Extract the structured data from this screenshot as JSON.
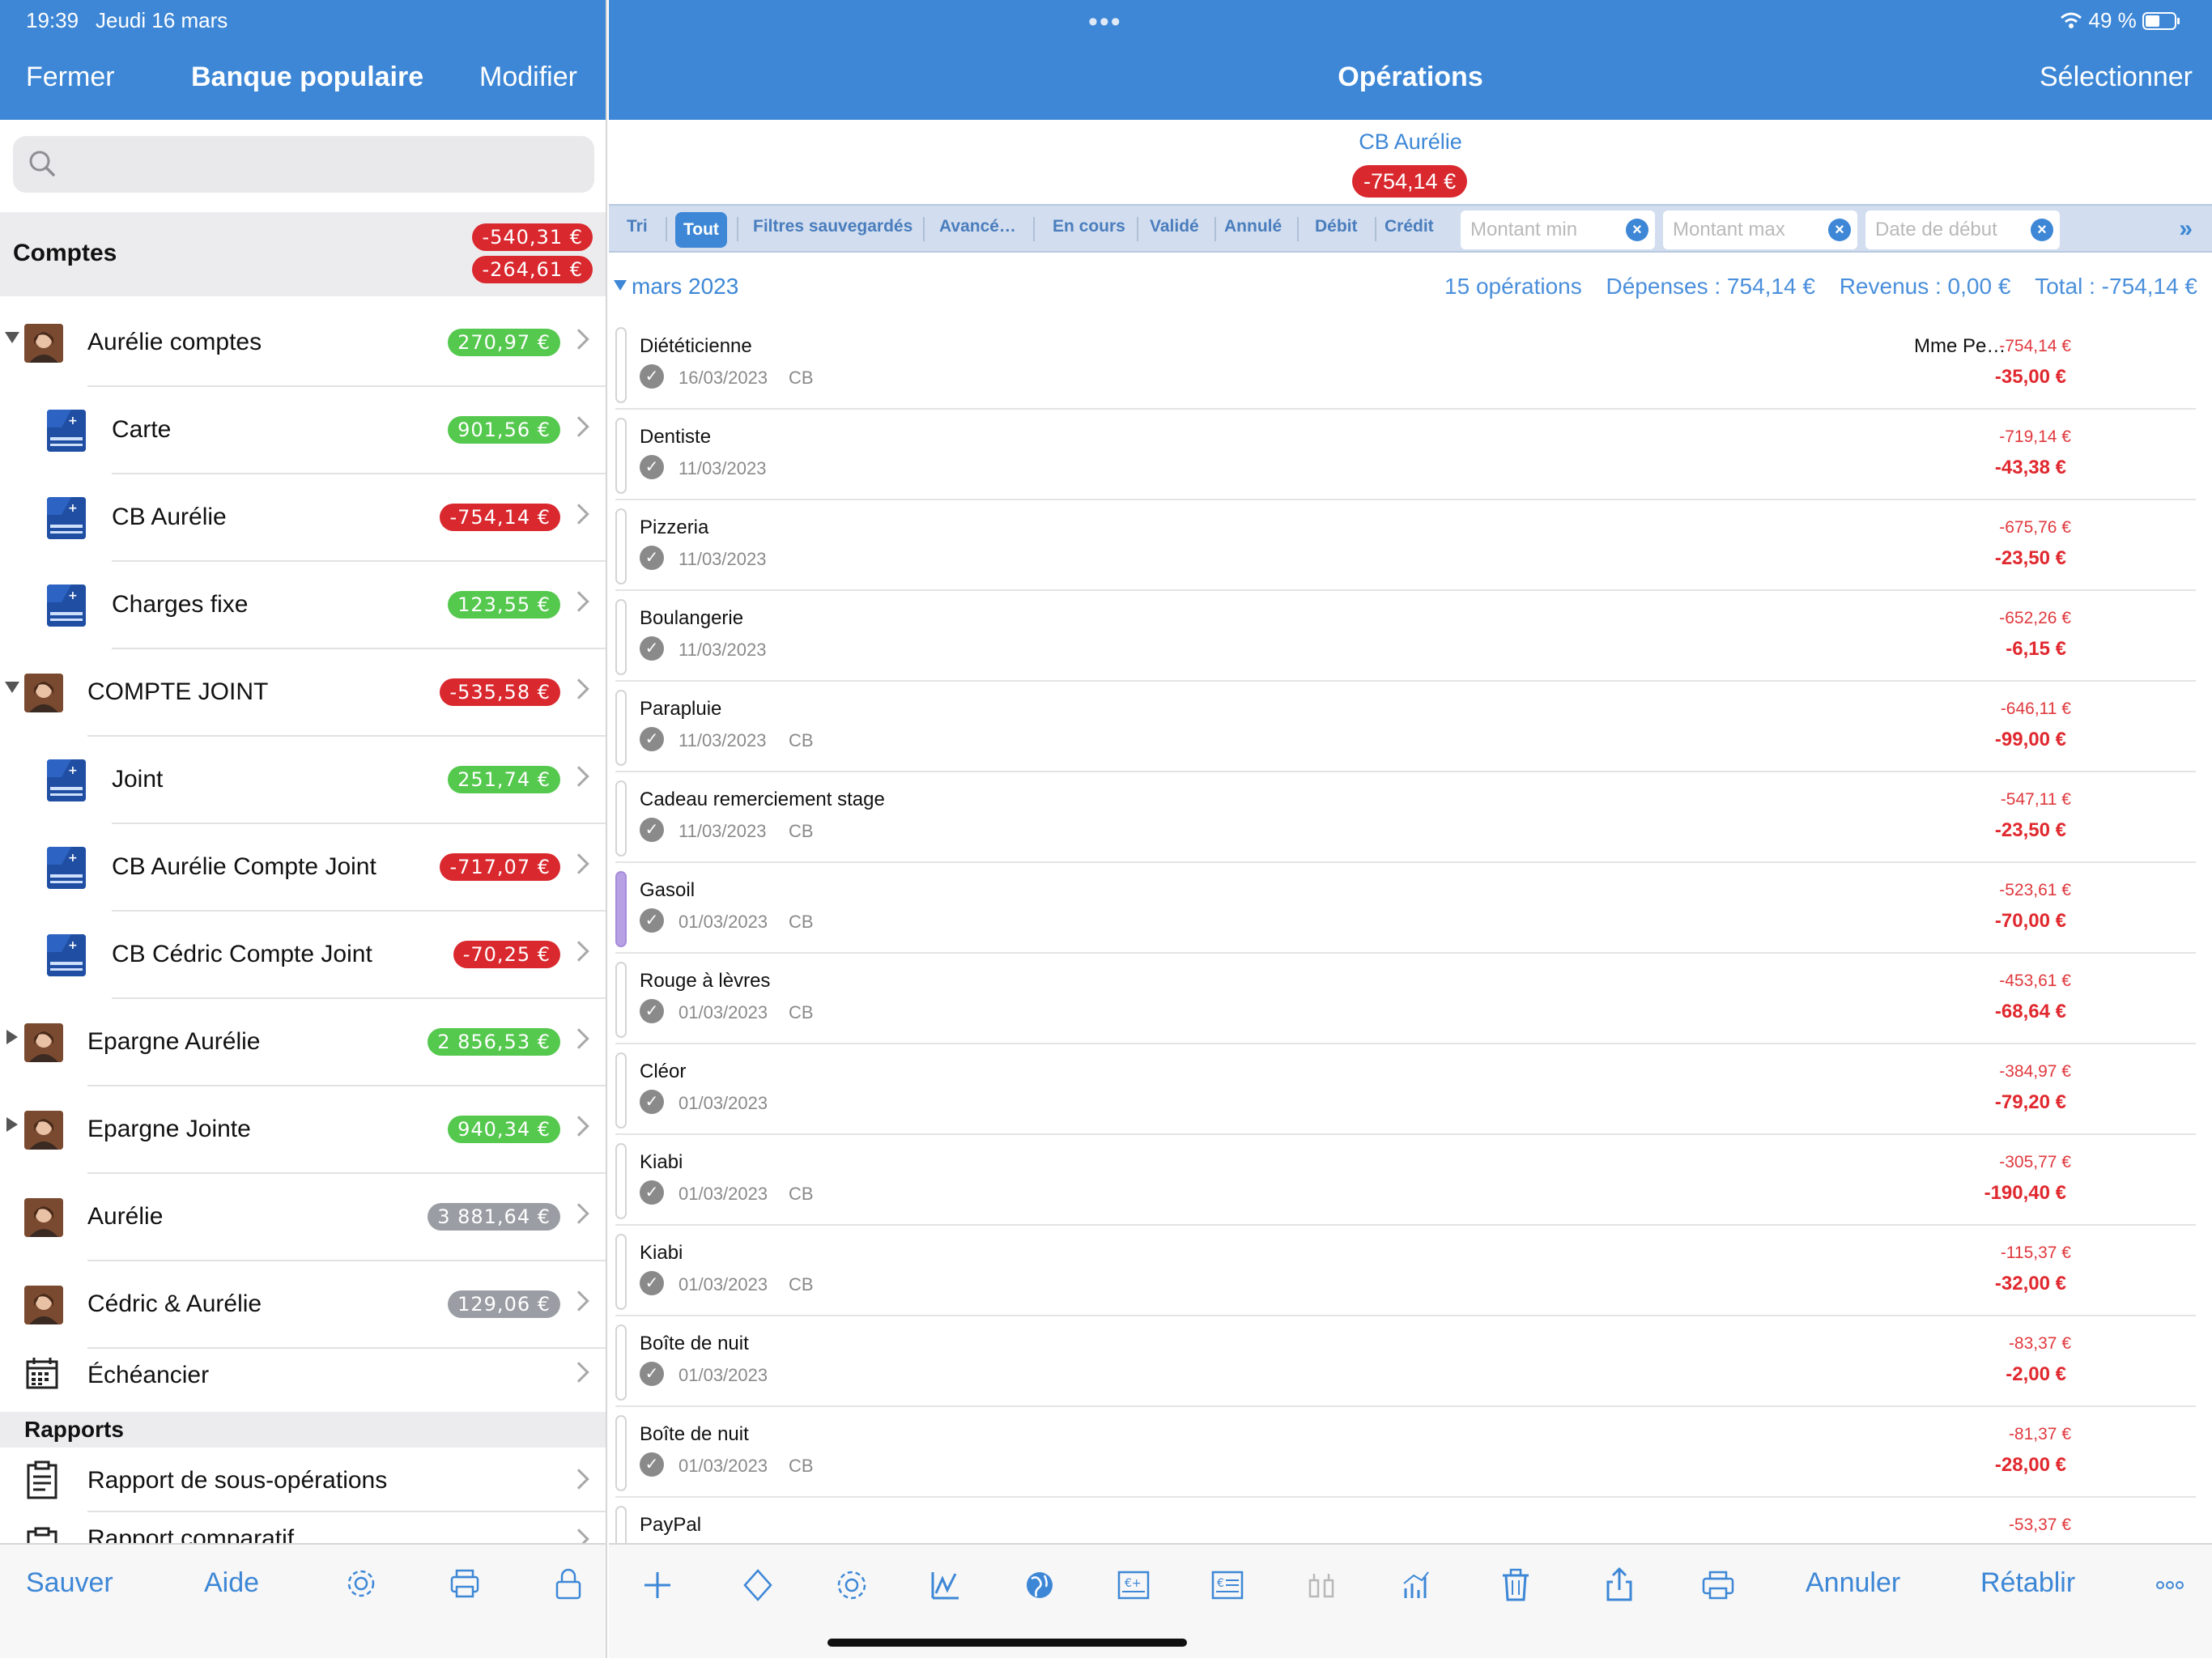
{
  "status": {
    "time": "19:39",
    "date": "Jeudi 16 mars",
    "battery": "49 %"
  },
  "left": {
    "close_label": "Fermer",
    "title": "Banque populaire",
    "edit_label": "Modifier",
    "search_placeholder": "",
    "section_comptes": "Comptes",
    "comptes_totals": [
      "-540,31 €",
      "-264,61 €"
    ],
    "accounts": [
      {
        "label": "Aurélie comptes",
        "balance": "270,97 €",
        "kind": "group",
        "expanded": true
      },
      {
        "label": "Carte",
        "balance": "901,56 €",
        "kind": "sub"
      },
      {
        "label": "CB Aurélie",
        "balance": "-754,14 €",
        "kind": "sub"
      },
      {
        "label": "Charges fixe",
        "balance": "123,55 €",
        "kind": "sub"
      },
      {
        "label": "COMPTE JOINT",
        "balance": "-535,58 €",
        "kind": "group",
        "expanded": true
      },
      {
        "label": "Joint",
        "balance": "251,74 €",
        "kind": "sub"
      },
      {
        "label": "CB Aurélie Compte Joint",
        "balance": "-717,07 €",
        "kind": "sub"
      },
      {
        "label": "CB Cédric Compte Joint",
        "balance": "-70,25 €",
        "kind": "sub"
      },
      {
        "label": "Epargne Aurélie",
        "balance": "2 856,53 €",
        "kind": "group",
        "expanded": false
      },
      {
        "label": "Epargne Jointe",
        "balance": "940,34 €",
        "kind": "group",
        "expanded": false
      },
      {
        "label": "Aurélie",
        "balance": "3 881,64 €",
        "kind": "single"
      },
      {
        "label": "Cédric & Aurélie",
        "balance": "129,06 €",
        "kind": "single"
      }
    ],
    "scheduler_label": "Échéancier",
    "section_rapports": "Rapports",
    "reports": [
      "Rapport de sous-opérations",
      "Rapport comparatif"
    ],
    "toolbar": {
      "save_label": "Sauver",
      "help_label": "Aide"
    }
  },
  "right": {
    "title": "Opérations",
    "select_label": "Sélectionner",
    "account_name": "CB Aurélie",
    "account_balance": "-754,14 €",
    "filters": {
      "tri": "Tri",
      "all": "Tout",
      "saved": "Filtres sauvegardés",
      "advanced": "Avancé…",
      "pending": "En cours",
      "validated": "Validé",
      "cancelled": "Annulé",
      "debit": "Débit",
      "credit": "Crédit",
      "min_placeholder": "Montant min",
      "max_placeholder": "Montant max",
      "start_placeholder": "Date de début",
      "more": "»"
    },
    "month": {
      "label": "mars 2023",
      "count": "15 opérations",
      "expenses": "Dépenses : 754,14 €",
      "income": "Revenus : 0,00 €",
      "total": "Total : -754,14 €"
    },
    "operations": [
      {
        "title": "Diététicienne",
        "date": "16/03/2023",
        "type": "CB",
        "tiers": "Mme Pe…",
        "running": "-754,14 €",
        "amount": "-35,00 €"
      },
      {
        "title": "Dentiste",
        "date": "11/03/2023",
        "type": "",
        "tiers": "",
        "running": "-719,14 €",
        "amount": "-43,38 €"
      },
      {
        "title": "Pizzeria",
        "date": "11/03/2023",
        "type": "",
        "tiers": "",
        "running": "-675,76 €",
        "amount": "-23,50 €"
      },
      {
        "title": "Boulangerie",
        "date": "11/03/2023",
        "type": "",
        "tiers": "",
        "running": "-652,26 €",
        "amount": "-6,15 €"
      },
      {
        "title": "Parapluie",
        "date": "11/03/2023",
        "type": "CB",
        "tiers": "",
        "running": "-646,11 €",
        "amount": "-99,00 €"
      },
      {
        "title": "Cadeau remerciement stage",
        "date": "11/03/2023",
        "type": "CB",
        "tiers": "",
        "running": "-547,11 €",
        "amount": "-23,50 €"
      },
      {
        "title": "Gasoil",
        "date": "01/03/2023",
        "type": "CB",
        "tiers": "",
        "running": "-523,61 €",
        "amount": "-70,00 €",
        "marked": true
      },
      {
        "title": "Rouge à lèvres",
        "date": "01/03/2023",
        "type": "CB",
        "tiers": "",
        "running": "-453,61 €",
        "amount": "-68,64 €"
      },
      {
        "title": "Cléor",
        "date": "01/03/2023",
        "type": "",
        "tiers": "",
        "running": "-384,97 €",
        "amount": "-79,20 €"
      },
      {
        "title": "Kiabi",
        "date": "01/03/2023",
        "type": "CB",
        "tiers": "",
        "running": "-305,77 €",
        "amount": "-190,40 €"
      },
      {
        "title": "Kiabi",
        "date": "01/03/2023",
        "type": "CB",
        "tiers": "",
        "running": "-115,37 €",
        "amount": "-32,00 €"
      },
      {
        "title": "Boîte de nuit",
        "date": "01/03/2023",
        "type": "",
        "tiers": "",
        "running": "-83,37 €",
        "amount": "-2,00 €"
      },
      {
        "title": "Boîte de nuit",
        "date": "01/03/2023",
        "type": "CB",
        "tiers": "",
        "running": "-81,37 €",
        "amount": "-28,00 €"
      },
      {
        "title": "PayPal",
        "date": "",
        "type": "",
        "tiers": "",
        "running": "-53,37 €",
        "amount": ""
      }
    ],
    "toolbar": {
      "cancel_label": "Annuler",
      "redo_label": "Rétablir"
    }
  },
  "colors": {
    "accent": "#3d87d6",
    "negative": "#d9282e",
    "positive": "#55c84e",
    "neutral": "#9a9ea4"
  },
  "icons": [
    "search-icon",
    "gear-icon",
    "print-icon",
    "lock-icon",
    "plus-icon",
    "diamond-icon",
    "chart-icon",
    "globe-icon",
    "euro-card-icon",
    "list-card-icon",
    "split-icon",
    "bar-chart-icon",
    "trash-icon",
    "share-icon",
    "more-icon",
    "calendar-icon",
    "report-icon",
    "wifi-icon",
    "battery-icon"
  ]
}
